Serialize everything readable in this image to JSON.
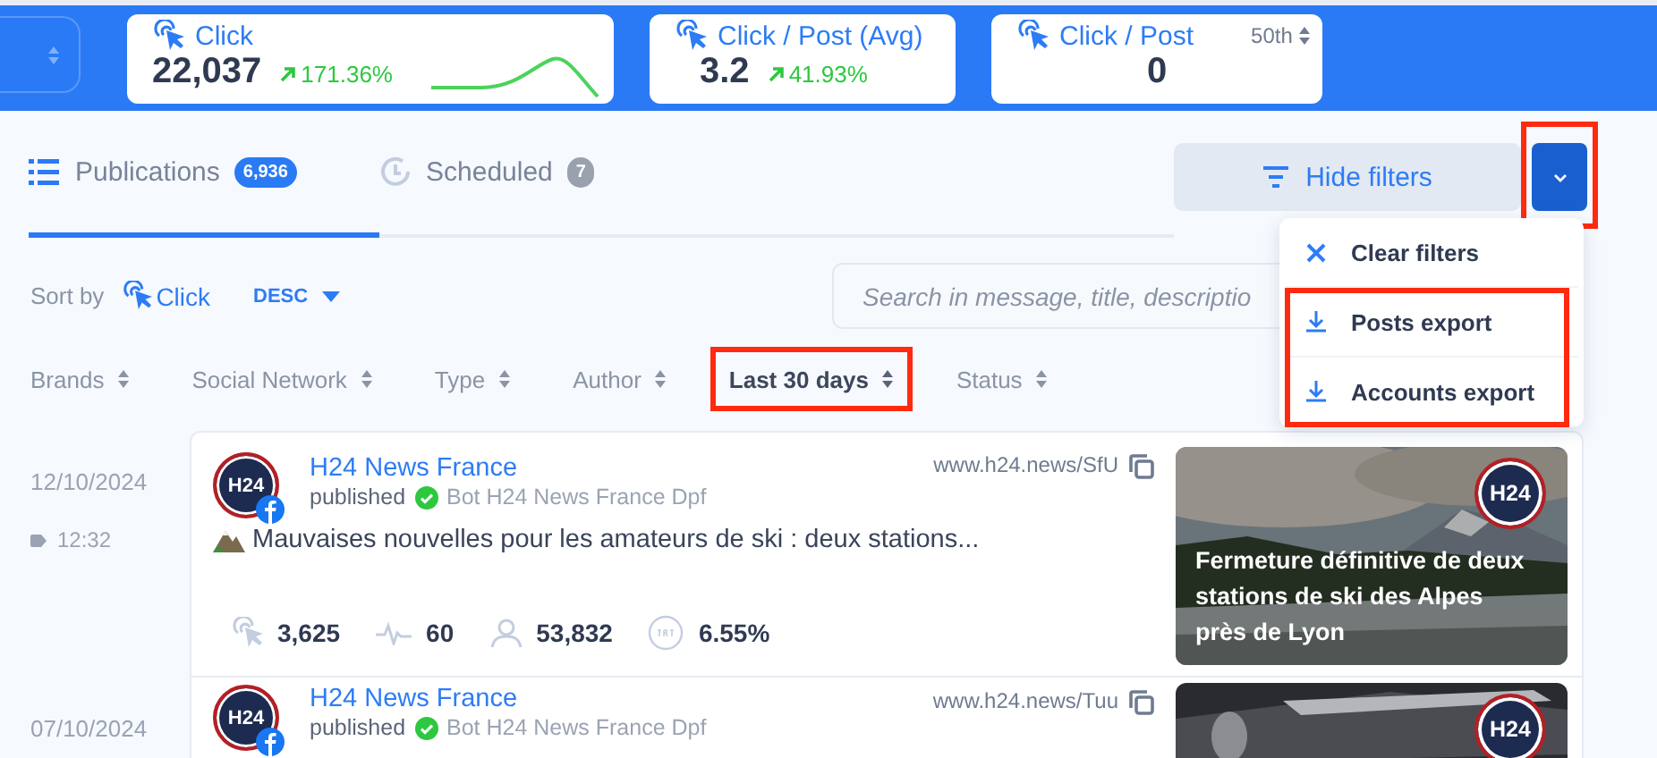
{
  "metrics": [
    {
      "kind": "trend",
      "title": "Click",
      "value": "22,037",
      "change": "171.36%"
    },
    {
      "kind": "trend",
      "title": "Click / Post (Avg)",
      "value": "3.2",
      "change": "41.93%"
    },
    {
      "kind": "percentile",
      "title": "Click / Post",
      "percentile": "50th",
      "value": "0"
    }
  ],
  "tabs": [
    {
      "kind": "list",
      "label": "Publications",
      "count": "6,936",
      "selected": true
    },
    {
      "kind": "clock",
      "label": "Scheduled",
      "count": "7",
      "selected": false
    }
  ],
  "filters_button": {
    "label": "Hide filters"
  },
  "menu_toggle": {
    "highlighted": true
  },
  "menu": {
    "sections": [
      {
        "highlighted": false,
        "items": [
          {
            "kind": "clear",
            "label": "Clear filters"
          }
        ]
      },
      {
        "highlighted": true,
        "items": [
          {
            "kind": "download",
            "label": "Posts export"
          },
          {
            "kind": "download",
            "label": "Accounts export"
          }
        ]
      }
    ]
  },
  "sort": {
    "label": "Sort by",
    "field": "Click",
    "order": "DESC"
  },
  "search": {
    "placeholder": "Search in message, title, descriptio"
  },
  "filters": [
    {
      "label": "Brands",
      "active": false,
      "highlighted": false
    },
    {
      "label": "Social Network",
      "active": false,
      "highlighted": false
    },
    {
      "label": "Type",
      "active": false,
      "highlighted": false
    },
    {
      "label": "Author",
      "active": false,
      "highlighted": false
    },
    {
      "label": "Last 30 days",
      "active": true,
      "highlighted": true
    },
    {
      "label": "Status",
      "active": false,
      "highlighted": false
    }
  ],
  "posts": [
    {
      "date": "12/10/2024",
      "time": "12:32",
      "avatar_text": "H24",
      "author": "H24 News France",
      "status": "published",
      "bot": "Bot H24 News France Dpf",
      "link": "www.h24.news/SfU",
      "message": "Mauvaises nouvelles pour les amateurs de ski : deux stations...",
      "stats": [
        {
          "kind": "clicks",
          "value": "3,625"
        },
        {
          "kind": "activity",
          "value": "60"
        },
        {
          "kind": "reach",
          "value": "53,832"
        },
        {
          "kind": "ctr",
          "value": "6.55%"
        }
      ],
      "preview": {
        "kind": "mountain",
        "badge": "H24",
        "title": "Fermeture définitive de deux stations de ski des Alpes près de Lyon"
      }
    },
    {
      "date": "07/10/2024",
      "avatar_text": "H24",
      "author": "H24 News France",
      "status": "published",
      "bot": "Bot H24 News France Dpf",
      "link": "www.h24.news/Tuu",
      "preview": {
        "kind": "dark",
        "badge": "H24"
      }
    }
  ]
}
